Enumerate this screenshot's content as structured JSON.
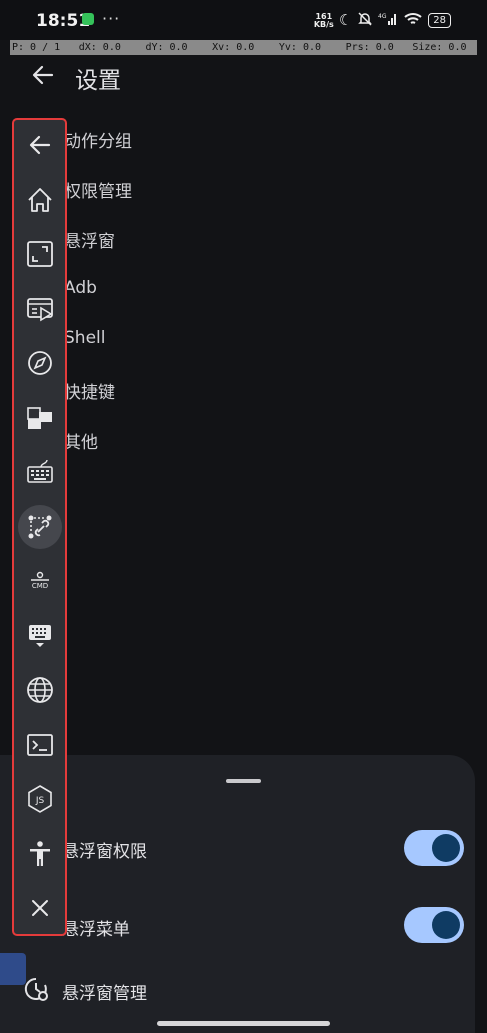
{
  "status_bar": {
    "time": "18:51",
    "dots": "···",
    "net_speed_value": "161",
    "net_speed_unit": "KB/s",
    "signal_label": "4G",
    "battery": "28",
    "icons": [
      "app-notification-icon",
      "moon-icon",
      "mute-icon",
      "signal-icon",
      "wifi-icon",
      "battery-icon"
    ]
  },
  "pointer_location": {
    "p": "P: 0 / 1",
    "dx": "dX: 0.0",
    "dy": "dY: 0.0",
    "xv": "Xv: 0.0",
    "yv": "Yv: 0.0",
    "prs": "Prs: 0.0",
    "size": "Size: 0.0"
  },
  "header": {
    "title": "设置"
  },
  "menu": {
    "items": [
      "动作分组",
      "权限管理",
      "悬浮窗",
      "Adb",
      "Shell",
      "快捷键",
      "其他"
    ]
  },
  "toolbar": {
    "border_color": "#e43b3b",
    "icons": [
      "back-arrow-icon",
      "home-icon",
      "fullscreen-icon",
      "slideshow-icon",
      "compass-icon",
      "translate-icon",
      "keyboard-icon",
      "link-path-icon",
      "cmd-icon",
      "keyboard-hide-icon",
      "globe-icon",
      "terminal-icon",
      "nodejs-icon",
      "accessibility-icon",
      "close-icon"
    ],
    "cmd_label": "CMD",
    "js_label": "JS"
  },
  "sheet": {
    "rows": [
      {
        "label": "悬浮窗权限",
        "enabled": true
      },
      {
        "label": "悬浮菜单",
        "enabled": true
      },
      {
        "label": "悬浮窗管理"
      }
    ],
    "toggle_on_color": "#a6c8ff",
    "knob_color": "#0f3b63"
  }
}
